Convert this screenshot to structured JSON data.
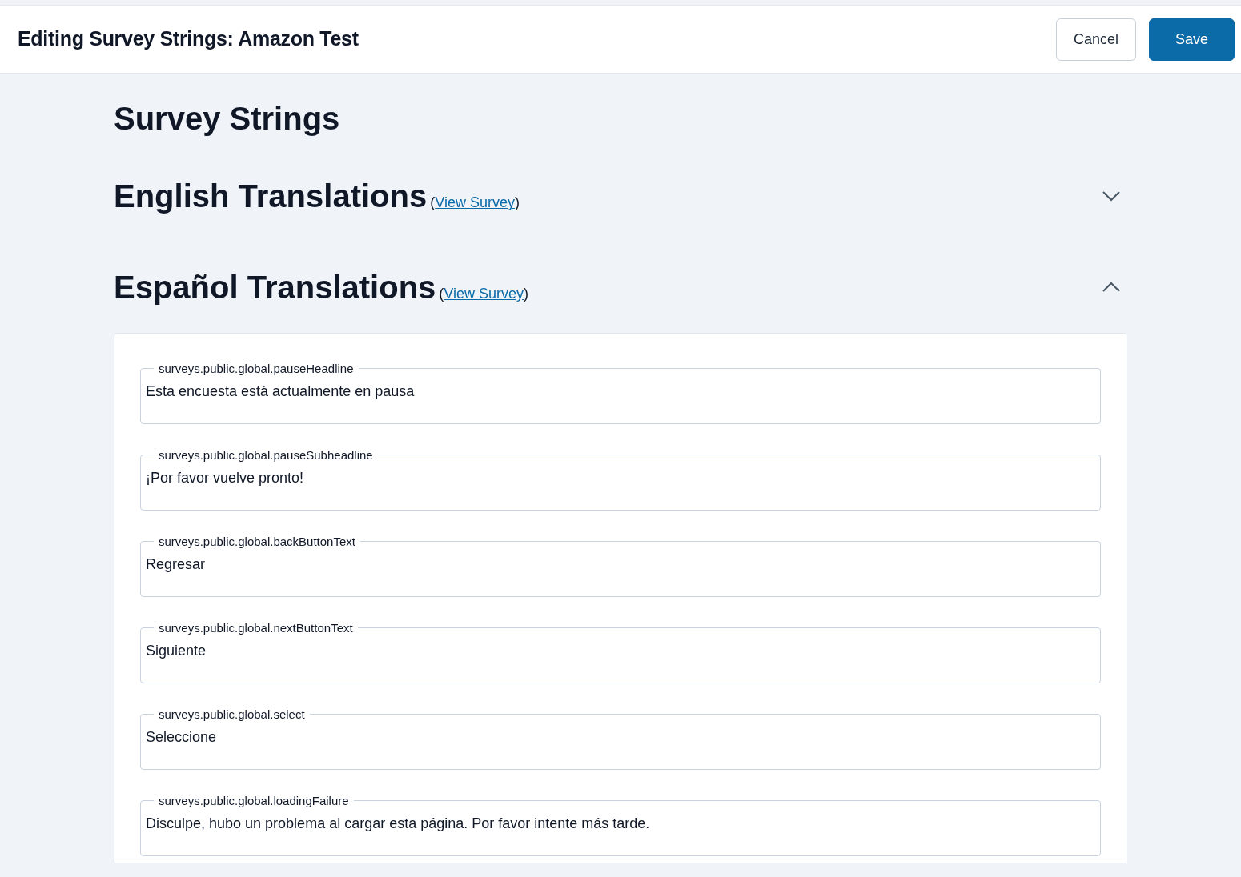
{
  "header": {
    "title": "Editing Survey Strings: Amazon Test",
    "buttons": [
      {
        "kind": "secondary",
        "label": "Cancel"
      },
      {
        "kind": "primary",
        "label": "Save"
      }
    ]
  },
  "page_title": "Survey Strings",
  "sections": [
    {
      "title": "English Translations",
      "paren_open": "(",
      "link": "View Survey",
      "paren_close": ")",
      "expanded": false
    },
    {
      "title": "Español Translations",
      "paren_open": "(",
      "link": "View Survey",
      "paren_close": ")",
      "expanded": true,
      "fields": [
        {
          "label": "surveys.public.global.pauseHeadline",
          "value": "Esta encuesta está actualmente en pausa"
        },
        {
          "label": "surveys.public.global.pauseSubheadline",
          "value": "¡Por favor vuelve pronto!"
        },
        {
          "label": "surveys.public.global.backButtonText",
          "value": "Regresar"
        },
        {
          "label": "surveys.public.global.nextButtonText",
          "value": "Siguiente"
        },
        {
          "label": "surveys.public.global.select",
          "value": "Seleccione"
        },
        {
          "label": "surveys.public.global.loadingFailure",
          "value": "Disculpe, hubo un problema al cargar esta página. Por favor intente más tarde."
        }
      ]
    }
  ]
}
